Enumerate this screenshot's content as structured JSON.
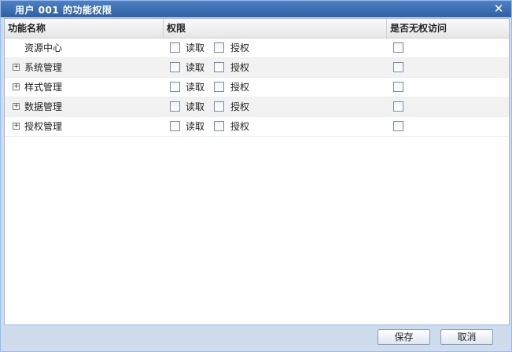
{
  "dialog": {
    "title": "用户 001 的功能权限",
    "close_icon": "close-icon"
  },
  "grid": {
    "columns": [
      "功能名称",
      "权限",
      "是否无权访问"
    ],
    "rows": [
      {
        "name": "资源中心",
        "expandable": false,
        "read_label": "读取",
        "grant_label": "授权"
      },
      {
        "name": "系统管理",
        "expandable": true,
        "read_label": "读取",
        "grant_label": "授权"
      },
      {
        "name": "样式管理",
        "expandable": true,
        "read_label": "读取",
        "grant_label": "授权"
      },
      {
        "name": "数据管理",
        "expandable": true,
        "read_label": "读取",
        "grant_label": "授权"
      },
      {
        "name": "授权管理",
        "expandable": true,
        "read_label": "读取",
        "grant_label": "授权"
      }
    ],
    "expander_glyph": "+"
  },
  "footer": {
    "save_label": "保存",
    "cancel_label": "取消"
  }
}
